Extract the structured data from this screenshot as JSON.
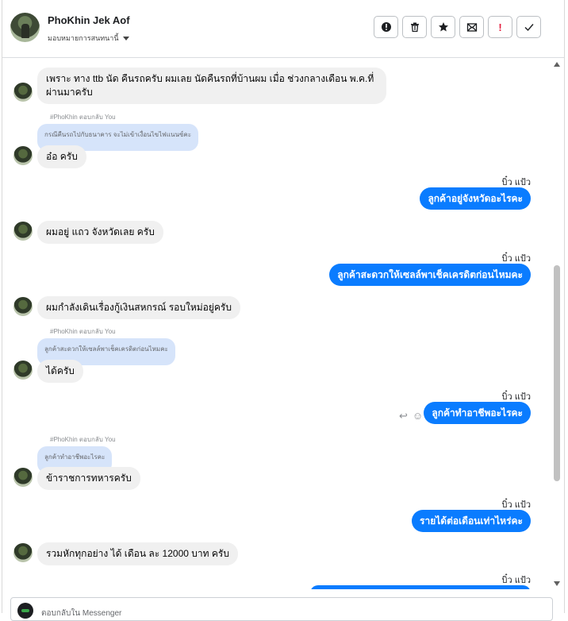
{
  "header": {
    "contact_name": "PhoKhin Jek Aof",
    "assign_label": "มอบหมายการสนทนานี้",
    "actions": [
      {
        "name": "info-icon",
        "glyph": "!"
      },
      {
        "name": "trash-icon",
        "glyph": ""
      },
      {
        "name": "star-icon",
        "glyph": "★"
      },
      {
        "name": "mail-icon",
        "glyph": "✉"
      },
      {
        "name": "flag-important-icon",
        "glyph": "!"
      },
      {
        "name": "checkmark-icon",
        "glyph": "✓"
      }
    ]
  },
  "messages": {
    "m1": "เพราะ ทาง ttb นัด คืนรถครับ ผมเลย นัดคืนรถที่บ้านผม เมื่อ ช่วงกลางเดือน พ.ค.ที่ผ่านมาครับ",
    "reply_label": "#PhoKhin ตอบกลับ You",
    "q1": "กรณีคืนรถไปกับธนาคาร จะไม่เข้าเงื่อนไขไฟแนนซ์คะ",
    "m2": "อ๋อ ครับ",
    "agent": "บิ๋ว แป้ว",
    "o1": "ลูกค้าอยู่จังหวัดอะไรคะ",
    "m3": "ผมอยู่ แถว จังหวัดเลย ครับ",
    "o2": "ลูกค้าสะดวกให้เซลล์พาเช็คเครดิตก่อนไหมคะ",
    "m4": "ผมกำลังเดินเรื่องกู้เงินสหกรณ์ รอบใหม่อยู่ครับ",
    "q2": "ลูกค้าสะดวกให้เซลล์พาเช็คเครดิตก่อนไหมคะ",
    "m5": "ได้ครับ",
    "o3": "ลูกค้าทำอาชีพอะไรคะ",
    "q3": "ลูกค้าทำอาชีพอะไรคะ",
    "m6": "ข้าราชการทหารครับ",
    "o4": "รายได้ต่อเดือนเท่าไหร่คะ",
    "m7": "รวมหักทุกอย่าง ได้ เดือน ละ 12000  บาท ครับ"
  },
  "composer": {
    "placeholder": "ตอบกลับใน Messenger"
  },
  "colors": {
    "outgoing": "#0a7cff",
    "incoming": "#f0f0f0",
    "quote": "#d6e4fa"
  }
}
